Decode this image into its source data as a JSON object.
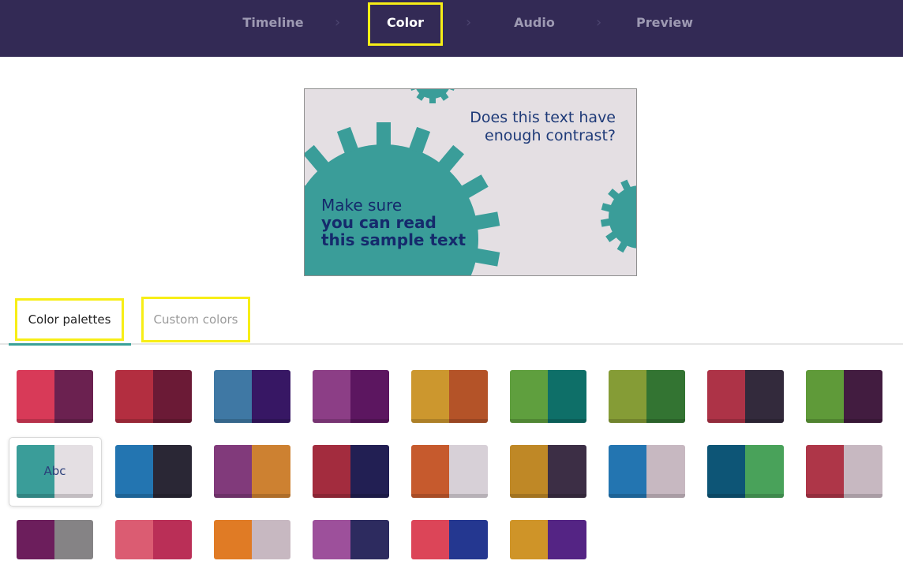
{
  "nav": {
    "steps": [
      {
        "label": "Timeline",
        "active": false
      },
      {
        "label": "Color",
        "active": true
      },
      {
        "label": "Audio",
        "active": false
      },
      {
        "label": "Preview",
        "active": false
      }
    ],
    "separator": "›",
    "bg_color": "#332a55",
    "highlight_color": "#f7ee16"
  },
  "preview": {
    "question_line1": "Does this text have",
    "question_line2": "enough contrast?",
    "main_line1": "Make sure",
    "main_line2": "you can read",
    "main_line3": "this sample text",
    "bg_color": "#e4dfe3",
    "gear_color": "#3a9d99",
    "text_color": "#152a6c"
  },
  "tabs": [
    {
      "label": "Color palettes",
      "active": true
    },
    {
      "label": "Custom colors",
      "active": false
    }
  ],
  "selected_palette_label": "Abc",
  "palettes": [
    {
      "colors": [
        "#d83a58",
        "#6b2150"
      ]
    },
    {
      "colors": [
        "#b32e40",
        "#6b1a36"
      ]
    },
    {
      "colors": [
        "#3f78a4",
        "#371764"
      ]
    },
    {
      "colors": [
        "#8c3e86",
        "#5c1660"
      ]
    },
    {
      "colors": [
        "#cc972e",
        "#b45328"
      ]
    },
    {
      "colors": [
        "#5f9f3e",
        "#0e6f68"
      ]
    },
    {
      "colors": [
        "#859c36",
        "#337432"
      ]
    },
    {
      "colors": [
        "#ad3347",
        "#332a3c"
      ]
    },
    {
      "colors": [
        "#5f9a39",
        "#421c40"
      ]
    },
    {
      "colors": [
        "#3a9d99",
        "#e4dfe3"
      ],
      "selected": true
    },
    {
      "colors": [
        "#2375b1",
        "#2a2735"
      ]
    },
    {
      "colors": [
        "#813a7b",
        "#cd8131"
      ]
    },
    {
      "colors": [
        "#a32c3e",
        "#221f53"
      ]
    },
    {
      "colors": [
        "#c65a2d",
        "#d7d0d7"
      ]
    },
    {
      "colors": [
        "#bf8826",
        "#3c2e45"
      ]
    },
    {
      "colors": [
        "#2375b1",
        "#c7b8c1"
      ]
    },
    {
      "colors": [
        "#0d5576",
        "#49a25a"
      ]
    },
    {
      "colors": [
        "#ae3648",
        "#c7b8c1"
      ]
    },
    {
      "colors": [
        "#6c1e5c",
        "#858385"
      ]
    },
    {
      "colors": [
        "#db5c72",
        "#ba2f57"
      ]
    },
    {
      "colors": [
        "#e07b25",
        "#c7b8c1"
      ]
    },
    {
      "colors": [
        "#9d509b",
        "#2d2b5f"
      ]
    },
    {
      "colors": [
        "#dc4558",
        "#243790"
      ]
    },
    {
      "colors": [
        "#cf9428",
        "#542484"
      ]
    }
  ]
}
